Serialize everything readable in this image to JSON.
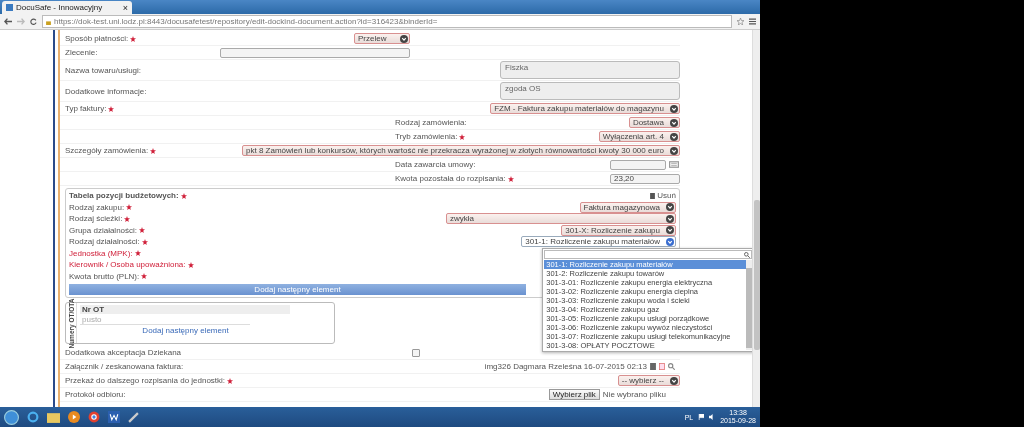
{
  "browser": {
    "tab_title": "DocuSafe - Innowacyjny",
    "tab_close": "×",
    "url": "https://dok-test.uni.lodz.pl:8443/docusafetest/repository/edit-dockind-document.action?id=316423&binderId="
  },
  "form_rows": [
    {
      "kind": "narrow-select",
      "label": "Sposób płatności:",
      "required": true,
      "value": "Przelew"
    },
    {
      "kind": "narrow-input",
      "label": "Zlecenie:",
      "required": false
    },
    {
      "kind": "textarea",
      "label": "Nazwa towaru/usługi:",
      "required": false,
      "value": "Fiszka"
    },
    {
      "kind": "textarea",
      "label": "Dodatkowe informacje:",
      "required": false,
      "value": "zgoda OS"
    },
    {
      "kind": "select",
      "label": "Typ faktury:",
      "required": true,
      "value": "FZM - Faktura zakupu materiałów do magazynu"
    },
    {
      "kind": "sub-select",
      "label": "Rodzaj zamówienia:",
      "required": false,
      "value": "Dostawa"
    },
    {
      "kind": "sub-select",
      "label": "Tryb zamówienia:",
      "required": true,
      "value": "Wyłączenia art. 4"
    },
    {
      "kind": "select",
      "label": "Szczegóły zamówienia:",
      "required": true,
      "value": "pkt 8 Zamówień lub konkursów, których wartość nie przekracza wyrażonej w złotych równowartości kwoty 30 000 euro"
    },
    {
      "kind": "sub-date",
      "label": "Data zawarcia umowy:",
      "required": false
    },
    {
      "kind": "sub-input",
      "label": "Kwota pozostała do rozpisania:",
      "required": true,
      "value": "23,20"
    },
    {
      "kind": "budget_table",
      "title": "Tabela pozycji budżetowych:",
      "required": true,
      "delete_label": "Usuń",
      "add_button": "Dodaj następny element",
      "rows": [
        {
          "kind": "select",
          "label": "Rodzaj zakupu:",
          "required": true,
          "error": false,
          "value": "Faktura magazynowa",
          "open": false
        },
        {
          "kind": "wide-select",
          "label": "Rodzaj ścieżki:",
          "required": true,
          "error": false,
          "value": "zwykła",
          "open": false
        },
        {
          "kind": "select",
          "label": "Grupa działalności:",
          "required": true,
          "error": false,
          "value": "301-X: Rozliczenie zakupu",
          "open": false
        },
        {
          "kind": "select",
          "label": "Rodzaj działalności:",
          "required": true,
          "error": false,
          "value": "301-1: Rozliczenie zakupu materiałów",
          "open": true,
          "dropdown": [
            {
              "label": "301-1: Rozliczenie zakupu materiałów",
              "selected": true
            },
            {
              "label": "301-2: Rozliczenie zakupu towarów",
              "selected": false
            },
            {
              "label": "301-3-01: Rozliczenie zakupu energia elektryczna",
              "selected": false
            },
            {
              "label": "301-3-02: Rozliczenie zakupu energia cieplna",
              "selected": false
            },
            {
              "label": "301-3-03: Rozliczenie zakupu woda i ścieki",
              "selected": false
            },
            {
              "label": "301-3-04: Rozliczenie zakupu gaz",
              "selected": false
            },
            {
              "label": "301-3-05: Rozliczenie zakupu usługi porządkowe",
              "selected": false
            },
            {
              "label": "301-3-06: Rozliczenie zakupu wywóz nieczystości",
              "selected": false
            },
            {
              "label": "301-3-07: Rozliczenie zakupu usługi telekomunikacyjne",
              "selected": false
            },
            {
              "label": "301-3-08: OPŁATY POCZTOWE",
              "selected": false
            }
          ]
        },
        {
          "kind": "label",
          "label": "Jednostka (MPK):",
          "required": true,
          "error": true
        },
        {
          "kind": "label",
          "label": "Kierownik / Osoba upoważniona:",
          "required": true,
          "error": true
        },
        {
          "kind": "label",
          "label": "Kwota brutto (PLN):",
          "required": true,
          "error": false
        }
      ]
    },
    {
      "kind": "ot_box",
      "side_label": "Numery OT/OTA",
      "column_header": "Nr OT",
      "placeholder": "pusto",
      "add_link": "Dodaj następny element"
    },
    {
      "kind": "checkbox",
      "label": "Dodatkowa akceptacja Dziekana",
      "required": false,
      "checked": false
    },
    {
      "kind": "attachment",
      "label": "Załącznik / zeskanowana faktura:",
      "required": false,
      "value": "img326 Dagmara Rzeleśna 16-07-2015 02:13"
    },
    {
      "kind": "select",
      "label": "Przekaż do dalszego rozpisania do jednostki:",
      "required": true,
      "value": "-- wybierz --"
    },
    {
      "kind": "file",
      "label": "Protokół odbioru:",
      "required": false,
      "button": "Wybierz plik",
      "status": "Nie wybrano pliku"
    }
  ],
  "taskbar": {
    "language": "PL",
    "time": "13:38",
    "date": "2015-09-28"
  }
}
